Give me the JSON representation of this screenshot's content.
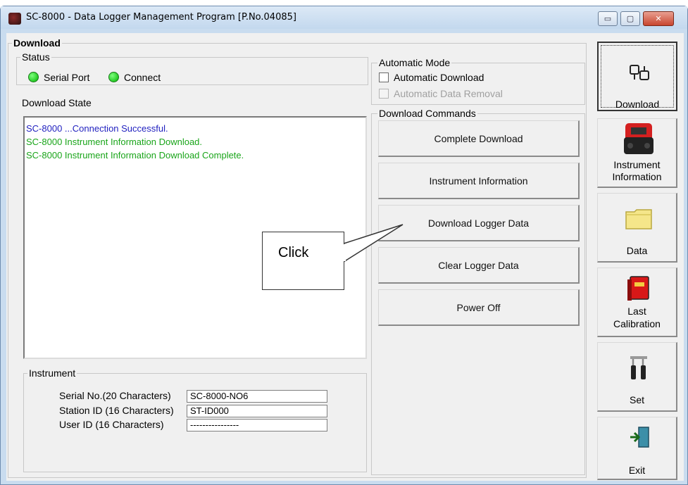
{
  "window": {
    "title": "SC-8000 - Data Logger Management Program [P.No.04085]",
    "controls": {
      "minimize": "▭",
      "maximize": "▢",
      "close": "✕"
    }
  },
  "download": {
    "group_label": "Download",
    "status": {
      "label": "Status",
      "serial_port": "Serial Port",
      "connect": "Connect",
      "led_color": "#00c000"
    },
    "state_label": "Download State",
    "log": [
      {
        "text": "SC-8000 ...Connection Successful.",
        "color": "#1f1fbf"
      },
      {
        "text": "SC-8000 Instrument Information Download.",
        "color": "#1aa51a"
      },
      {
        "text": "SC-8000 Instrument Information Download Complete.",
        "color": "#1aa51a"
      }
    ],
    "auto_mode": {
      "label": "Automatic Mode",
      "automatic_download": "Automatic Download",
      "automatic_data_removal": "Automatic Data Removal",
      "automatic_download_checked": false,
      "automatic_data_removal_enabled": false
    },
    "commands": {
      "label": "Download Commands",
      "buttons": [
        "Complete Download",
        "Instrument Information",
        "Download Logger Data",
        "Clear Logger Data",
        "Power Off"
      ]
    },
    "instrument": {
      "label": "Instrument",
      "serial_label": "Serial No.(20 Characters)",
      "serial_value": "SC-8000-NO6",
      "station_label": "Station ID (16 Characters)",
      "station_value": "ST-ID000",
      "user_label": "User ID (16 Characters)",
      "user_value": "----------------"
    }
  },
  "callout": {
    "text": "Click"
  },
  "sidebar": {
    "download": "Download",
    "instrument_1": "Instrument",
    "instrument_2": "Information",
    "data": "Data",
    "last_1": "Last",
    "last_2": "Calibration",
    "set": "Set",
    "exit": "Exit"
  }
}
